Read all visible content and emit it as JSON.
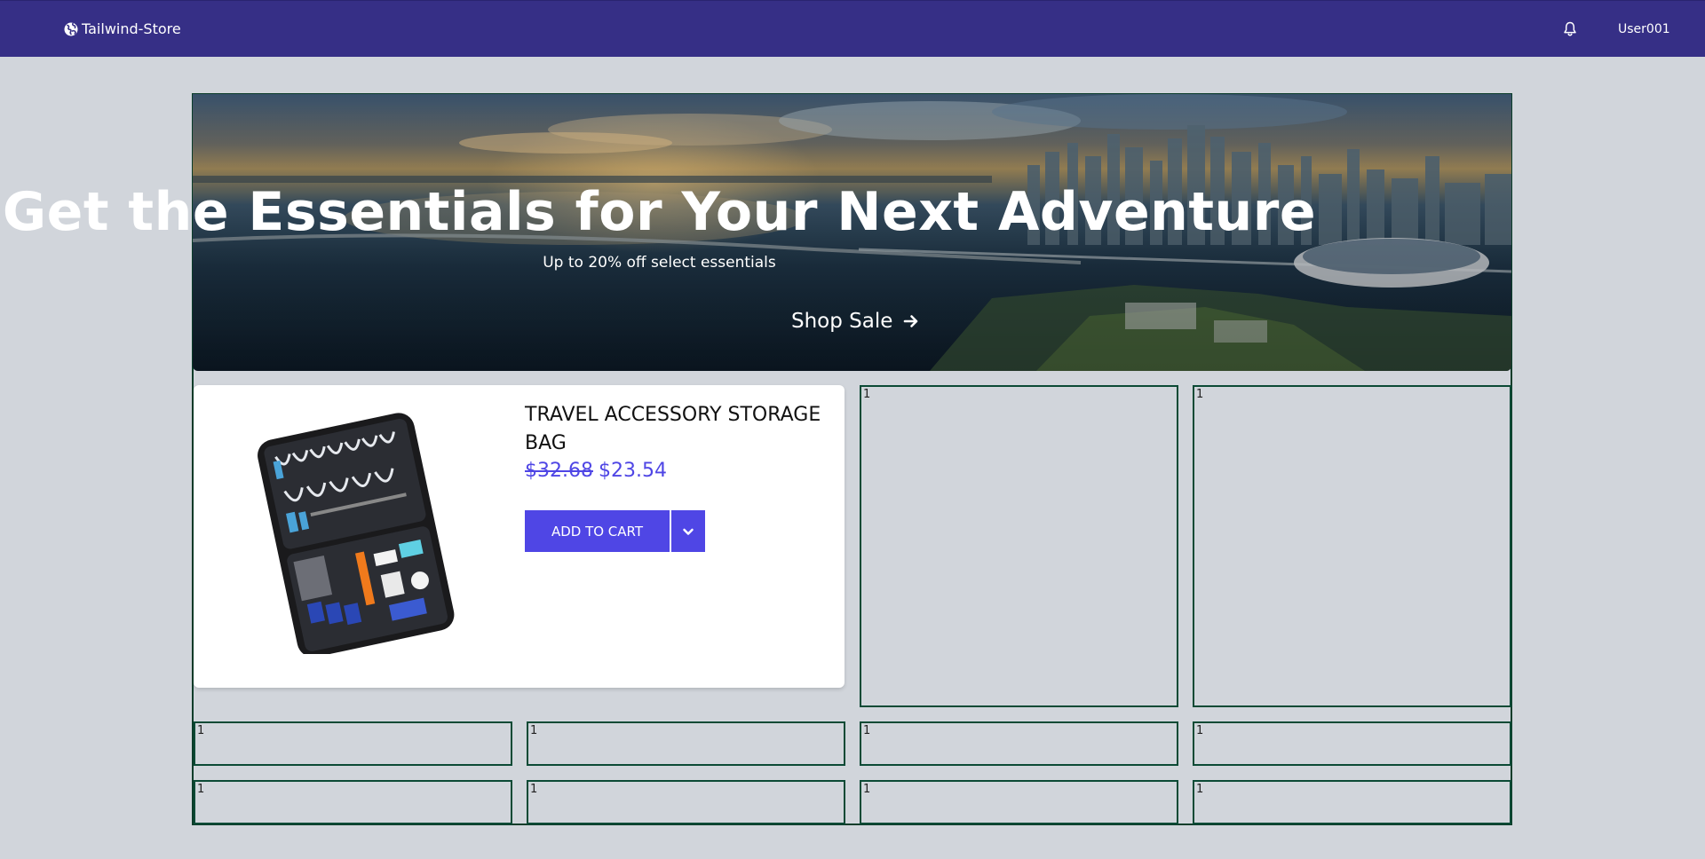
{
  "nav": {
    "brand": "Tailwind-Store",
    "brand_icon": "globe-icon",
    "notification_icon": "bell-icon",
    "user": "User001",
    "colors": {
      "background": "#362f86",
      "text": "#ffffff"
    }
  },
  "hero": {
    "title": "Get the Essentials for Your Next Adventure",
    "subtitle": "Up to 20% off select essentials",
    "cta_label": "Shop Sale",
    "cta_icon": "arrow-right-icon"
  },
  "product": {
    "title": "TRAVEL ACCESSORY STORAGE BAG",
    "old_price": "$32.68",
    "price": "$23.54",
    "add_to_cart_label": "ADD TO CART",
    "dropdown_icon": "chevron-down-icon",
    "accent_color": "#4f46e5"
  },
  "tiles": {
    "side": [
      "1",
      "1"
    ],
    "row1": [
      "1",
      "1",
      "1",
      "1"
    ],
    "row2": [
      "1",
      "1",
      "1",
      "1"
    ]
  }
}
